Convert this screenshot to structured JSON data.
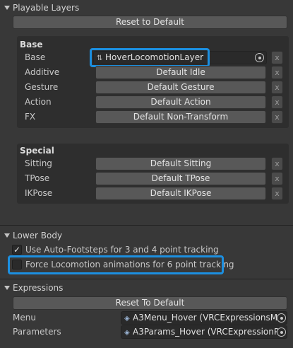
{
  "playable_layers": {
    "title": "Playable Layers",
    "reset_label": "Reset to Default",
    "base_section": {
      "title": "Base",
      "rows": [
        {
          "label": "Base",
          "value": "HoverLocomotionLayer",
          "x": "x"
        },
        {
          "label": "Additive",
          "value": "Default Idle",
          "x": "x"
        },
        {
          "label": "Gesture",
          "value": "Default Gesture",
          "x": "x"
        },
        {
          "label": "Action",
          "value": "Default Action",
          "x": "x"
        },
        {
          "label": "FX",
          "value": "Default Non-Transform",
          "x": "x"
        }
      ]
    },
    "special_section": {
      "title": "Special",
      "rows": [
        {
          "label": "Sitting",
          "value": "Default Sitting",
          "x": "x"
        },
        {
          "label": "TPose",
          "value": "Default TPose",
          "x": "x"
        },
        {
          "label": "IKPose",
          "value": "Default IKPose",
          "x": "x"
        }
      ]
    }
  },
  "lower_body": {
    "title": "Lower Body",
    "auto_footsteps": {
      "label": "Use Auto-Footsteps for 3 and 4 point tracking",
      "checked": true
    },
    "force_locomotion": {
      "label": "Force Locomotion animations for 6 point tracking",
      "checked": false
    }
  },
  "expressions": {
    "title": "Expressions",
    "reset_label": "Reset To Default",
    "menu": {
      "label": "Menu",
      "value": "A3Menu_Hover (VRCExpressionsMe"
    },
    "parameters": {
      "label": "Parameters",
      "value": "A3Params_Hover (VRCExpressionPa"
    }
  },
  "colors": {
    "background": "#383838",
    "panel": "#2e2e2e",
    "button": "#585858",
    "highlight": "#1c8fe0"
  }
}
